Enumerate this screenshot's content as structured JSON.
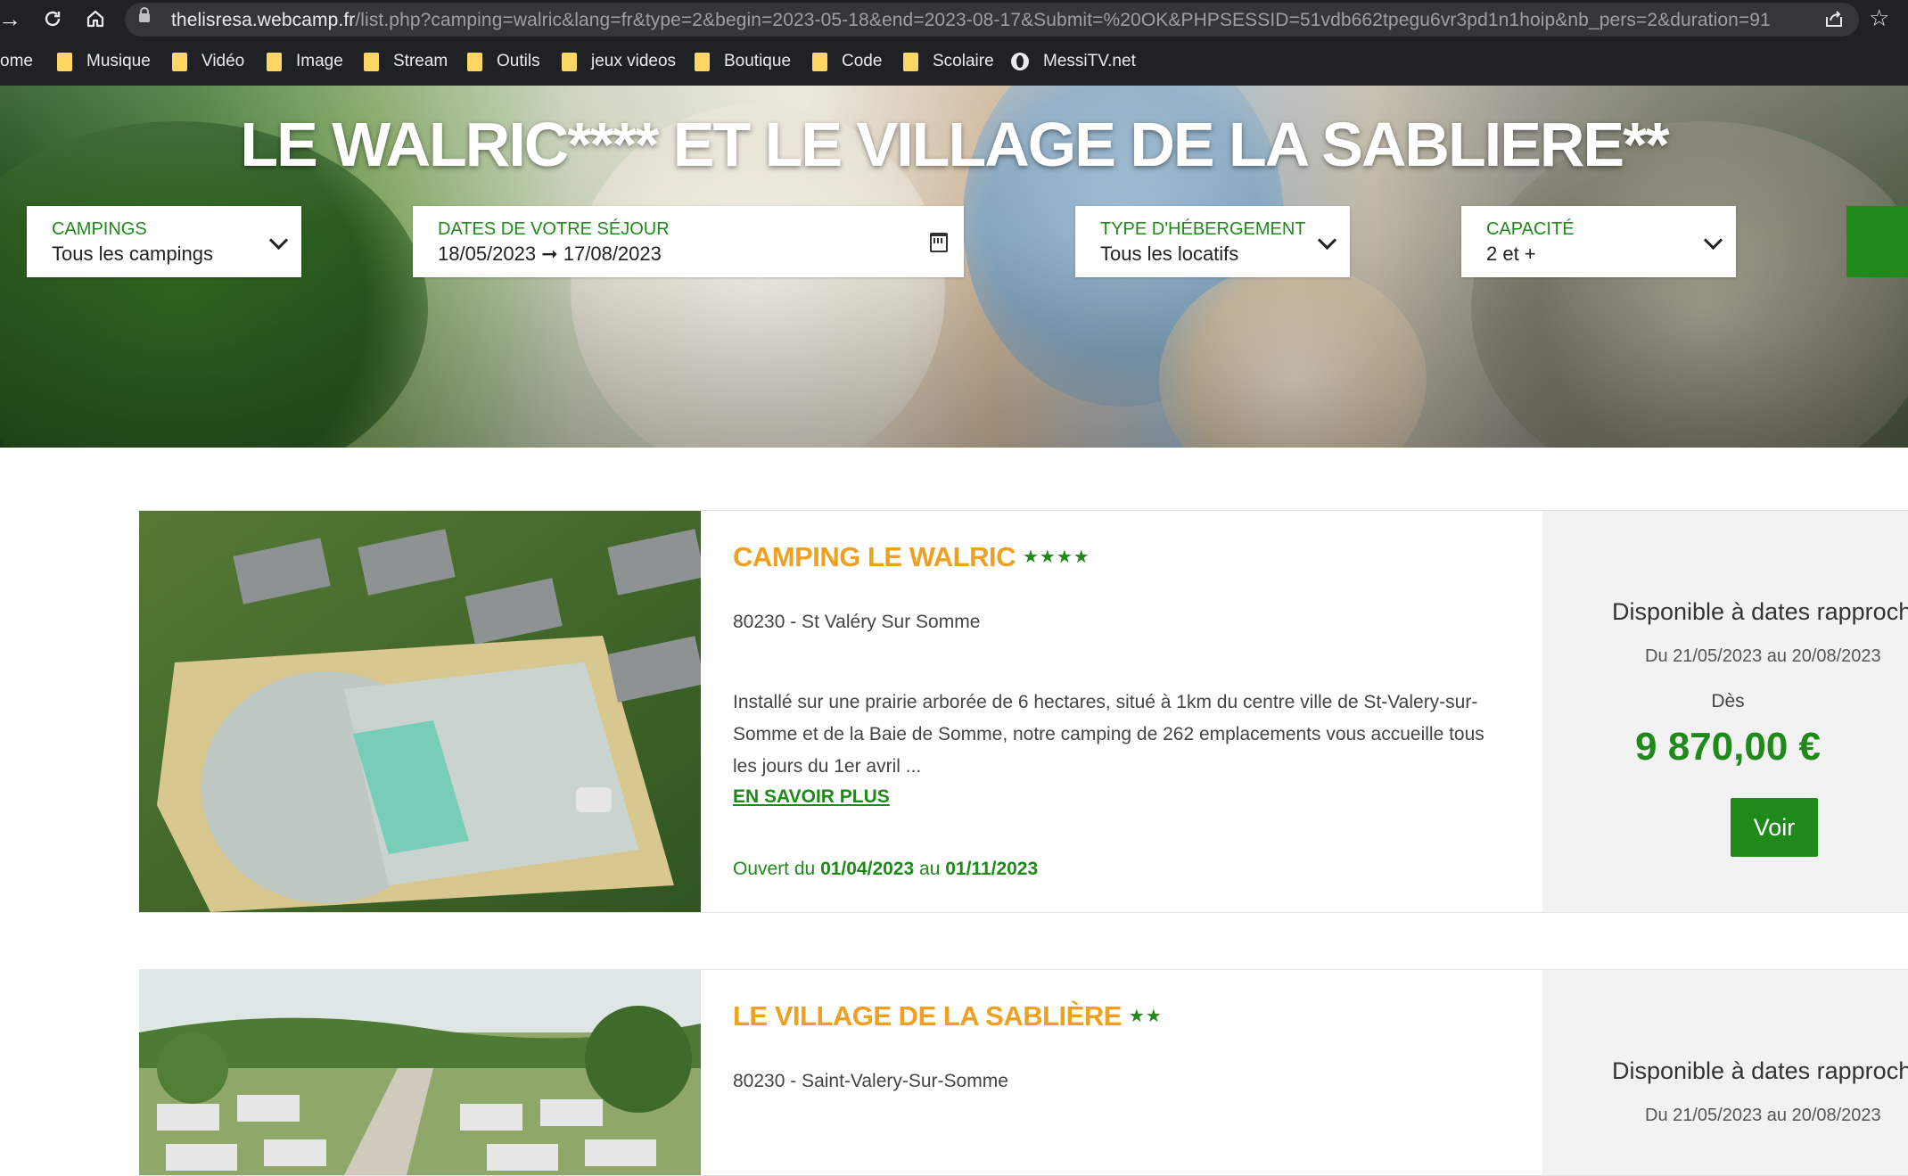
{
  "browser": {
    "url_host": "thelisresa.webcamp.fr",
    "url_path": "/list.php?camping=walric&lang=fr&type=2&begin=2023-05-18&end=2023-08-17&Submit=%20OK&PHPSESSID=51vdb662tpegu6vr3pd1n1hoip&nb_pers=2&duration=91",
    "bookmarks": [
      {
        "label": "ome",
        "icon": "none"
      },
      {
        "label": "Musique",
        "icon": "folder-icon"
      },
      {
        "label": "Vidéo",
        "icon": "folder-icon"
      },
      {
        "label": "Image",
        "icon": "folder-icon"
      },
      {
        "label": "Stream",
        "icon": "folder-icon"
      },
      {
        "label": "Outils",
        "icon": "folder-icon"
      },
      {
        "label": "jeux videos",
        "icon": "folder-icon"
      },
      {
        "label": "Boutique",
        "icon": "folder-icon"
      },
      {
        "label": "Code",
        "icon": "folder-icon"
      },
      {
        "label": "Scolaire",
        "icon": "folder-icon"
      },
      {
        "label": "MessiTV.net",
        "icon": "globe-icon"
      }
    ]
  },
  "hero": {
    "title": "LE WALRIC**** ET LE VILLAGE DE LA SABLIERE**"
  },
  "filters": {
    "campings": {
      "label": "CAMPINGS",
      "value": "Tous les campings"
    },
    "dates": {
      "label": "DATES DE VOTRE SÉJOUR",
      "value": "18/05/2023 ➞ 17/08/2023"
    },
    "type": {
      "label": "TYPE D'HÉBERGEMENT",
      "value": "Tous les locatifs"
    },
    "capacity": {
      "label": "CAPACITÉ",
      "value": "2 et +"
    }
  },
  "listings": [
    {
      "title": "CAMPING LE WALRIC",
      "stars": "★★★★",
      "address": "80230 - St Valéry Sur Somme",
      "description": "Installé sur une prairie arborée de 6 hectares, situé à 1km du centre ville de St-Valery-sur-Somme et de la Baie de Somme, notre camping de 262 emplacements vous accueille tous les jours du 1er avril ...",
      "more_label": "EN SAVOIR PLUS",
      "open_prefix": "Ouvert du",
      "open_from": "01/04/2023",
      "open_mid": "au",
      "open_to": "01/11/2023",
      "availability": "Disponible à dates rapproche",
      "avail_dates": "Du 21/05/2023 au 20/08/2023",
      "from_label": "Dès",
      "price": "9 870,00 €",
      "button": "Voir"
    },
    {
      "title": "LE VILLAGE DE LA SABLIÈRE",
      "stars": "★★",
      "address": "80230 - Saint-Valery-Sur-Somme",
      "availability": "Disponible à dates rapproche",
      "avail_dates": "Du 21/05/2023 au 20/08/2023"
    }
  ],
  "colors": {
    "brand_green": "#1f8a1a",
    "title_orange": "#f0a020",
    "chrome_dark": "#202124",
    "folder_yellow": "#fdd663"
  }
}
